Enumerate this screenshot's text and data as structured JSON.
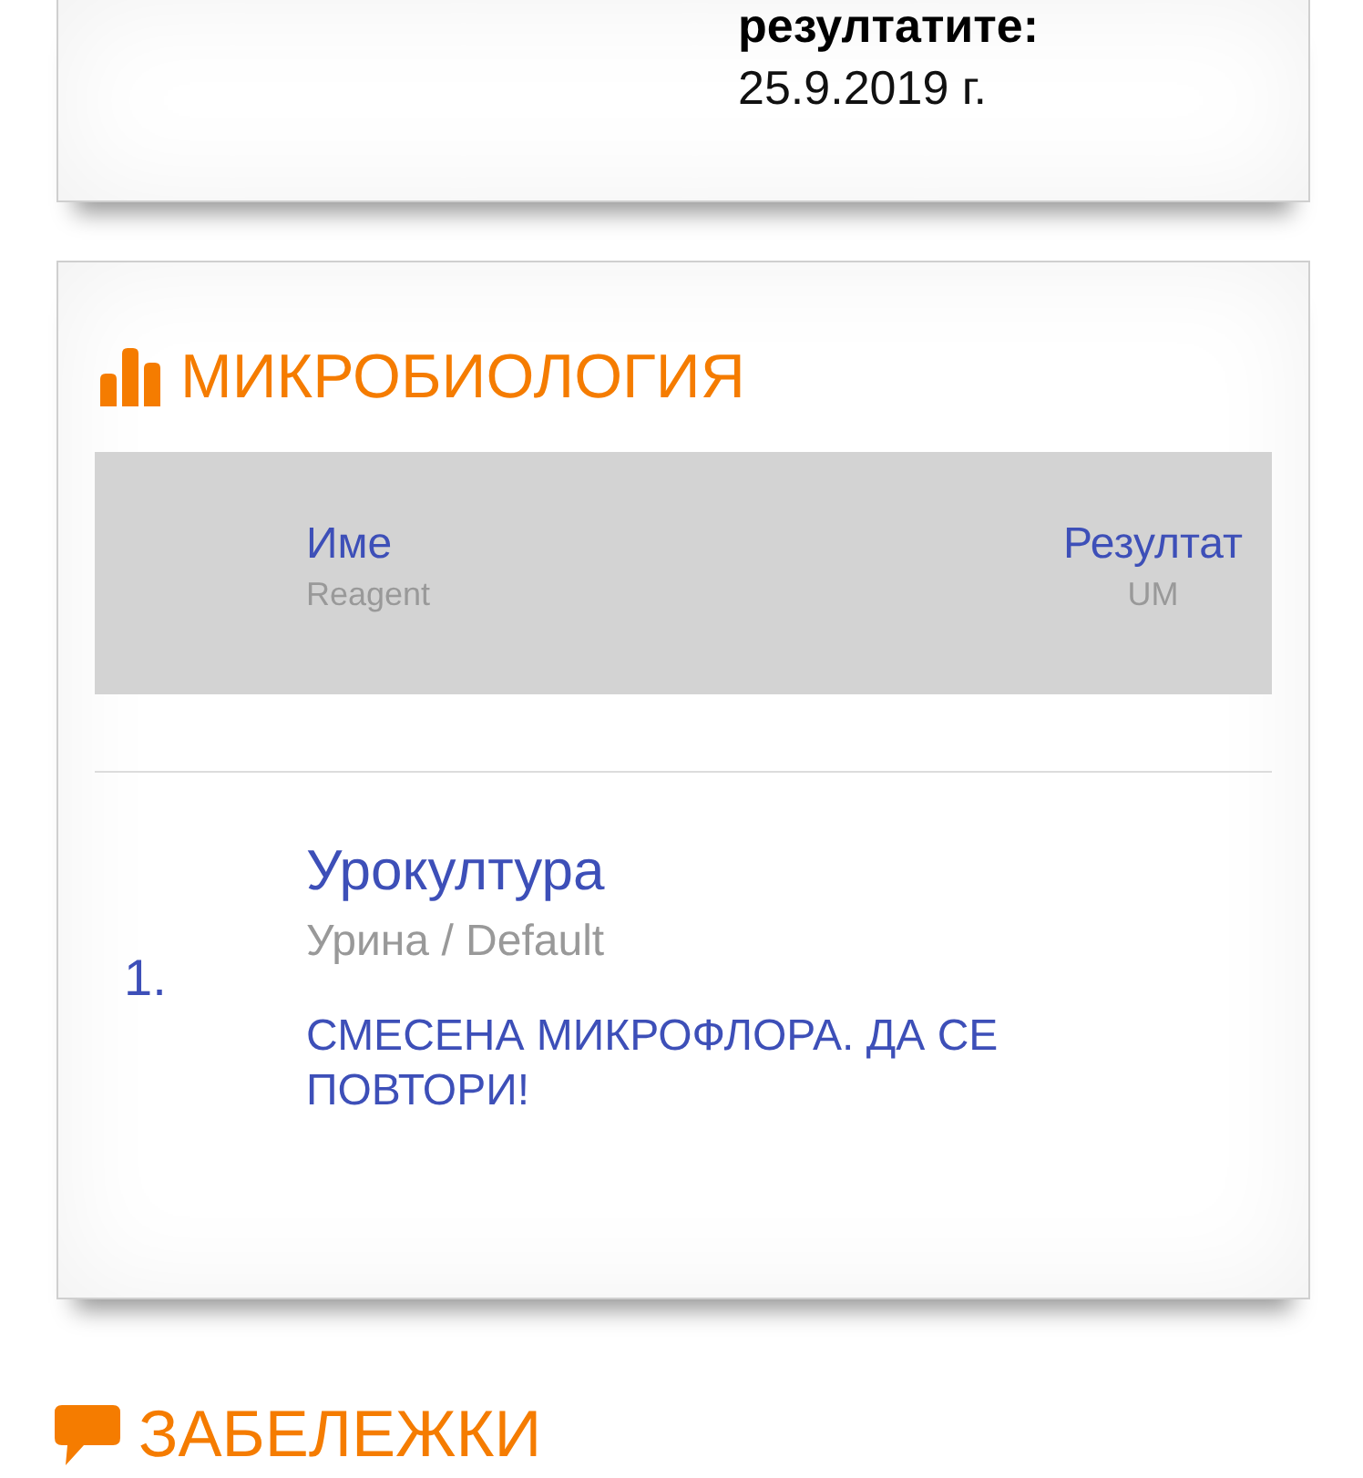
{
  "summary_card": {
    "result_date": {
      "label": "резултатите:",
      "value": "25.9.2019 г."
    }
  },
  "section": {
    "title": "МИКРОБИОЛОГИЯ",
    "table": {
      "columns": [
        {
          "title": "Име",
          "subtitle": "Reagent"
        },
        {
          "title": "Резултат",
          "subtitle": "UM"
        }
      ],
      "rows": [
        {
          "number": "1.",
          "name": "Урокултура",
          "detail": "Урина / Default",
          "result": "СМЕСЕНА МИКРОФЛОРА. ДА СЕ ПОВТОРИ!"
        }
      ]
    }
  },
  "notes": {
    "title": "ЗАБЕЛЕЖКИ"
  }
}
